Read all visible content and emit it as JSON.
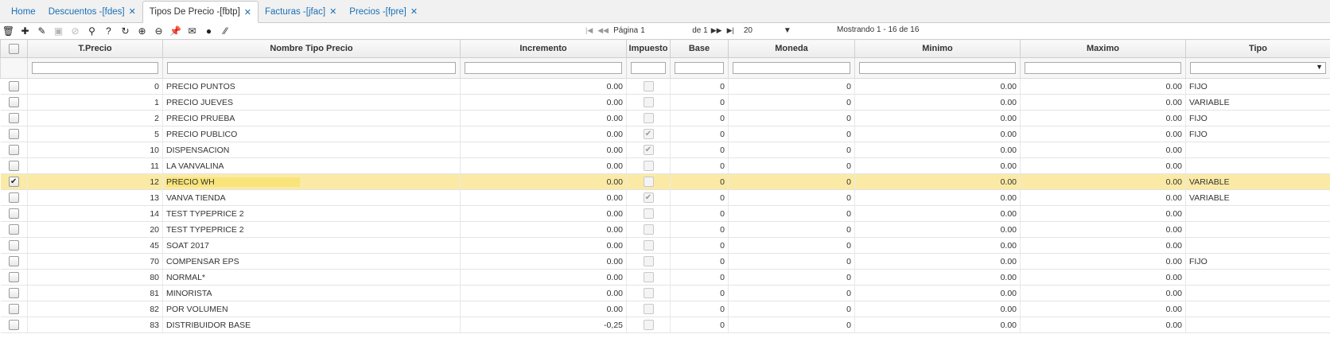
{
  "tabs": [
    {
      "label": "Home",
      "closable": false,
      "active": false
    },
    {
      "label": "Descuentos -[fdes]",
      "closable": true,
      "active": false
    },
    {
      "label": "Tipos De Precio -[fbtp]",
      "closable": true,
      "active": true
    },
    {
      "label": "Facturas -[jfac]",
      "closable": true,
      "active": false
    },
    {
      "label": "Precios -[fpre]",
      "closable": true,
      "active": false
    }
  ],
  "toolbar": {
    "icons": [
      "trash-icon",
      "add-icon",
      "edit-icon",
      "save-icon",
      "cancel-icon",
      "search-icon",
      "help-icon",
      "refresh-icon",
      "zoom-in-icon",
      "zoom-out-icon",
      "pin-icon",
      "mail-icon",
      "plus-circle-icon",
      "resize-icon"
    ]
  },
  "pager": {
    "first": "|◀",
    "prev": "◀◀",
    "page_label": "Página",
    "page_value": "1",
    "of_label": "de 1",
    "next": "▶▶",
    "last": "▶|",
    "page_size": "20",
    "showing": "Mostrando 1 - 16 de 16"
  },
  "columns": {
    "tprecio": "T.Precio",
    "nombre": "Nombre Tipo Precio",
    "incremento": "Incremento",
    "impuesto": "Impuesto",
    "base": "Base",
    "moneda": "Moneda",
    "minimo": "Minimo",
    "maximo": "Maximo",
    "tipo": "Tipo"
  },
  "rows": [
    {
      "id": "0",
      "name": "PRECIO PUNTOS",
      "inc": "0.00",
      "tax": false,
      "base": "0",
      "moneda": "0",
      "min": "0.00",
      "max": "0.00",
      "tipo": "FIJO",
      "selected": false
    },
    {
      "id": "1",
      "name": "PRECIO JUEVES",
      "inc": "0.00",
      "tax": false,
      "base": "0",
      "moneda": "0",
      "min": "0.00",
      "max": "0.00",
      "tipo": "VARIABLE",
      "selected": false
    },
    {
      "id": "2",
      "name": "PRECIO PRUEBA",
      "inc": "0.00",
      "tax": false,
      "base": "0",
      "moneda": "0",
      "min": "0.00",
      "max": "0.00",
      "tipo": "FIJO",
      "selected": false
    },
    {
      "id": "5",
      "name": "PRECIO PUBLICO",
      "inc": "0.00",
      "tax": true,
      "base": "0",
      "moneda": "0",
      "min": "0.00",
      "max": "0.00",
      "tipo": "FIJO",
      "selected": false
    },
    {
      "id": "10",
      "name": "DISPENSACION",
      "inc": "0.00",
      "tax": true,
      "base": "0",
      "moneda": "0",
      "min": "0.00",
      "max": "0.00",
      "tipo": "",
      "selected": false
    },
    {
      "id": "11",
      "name": "LA VANVALINA",
      "inc": "0.00",
      "tax": false,
      "base": "0",
      "moneda": "0",
      "min": "0.00",
      "max": "0.00",
      "tipo": "",
      "selected": false
    },
    {
      "id": "12",
      "name": "PRECIO WH",
      "inc": "0.00",
      "tax": false,
      "base": "0",
      "moneda": "0",
      "min": "0.00",
      "max": "0.00",
      "tipo": "VARIABLE",
      "selected": true
    },
    {
      "id": "13",
      "name": "VANVA TIENDA",
      "inc": "0.00",
      "tax": true,
      "base": "0",
      "moneda": "0",
      "min": "0.00",
      "max": "0.00",
      "tipo": "VARIABLE",
      "selected": false
    },
    {
      "id": "14",
      "name": "TEST TYPEPRICE 2",
      "inc": "0.00",
      "tax": false,
      "base": "0",
      "moneda": "0",
      "min": "0.00",
      "max": "0.00",
      "tipo": "",
      "selected": false
    },
    {
      "id": "20",
      "name": "TEST TYPEPRICE 2",
      "inc": "0.00",
      "tax": false,
      "base": "0",
      "moneda": "0",
      "min": "0.00",
      "max": "0.00",
      "tipo": "",
      "selected": false
    },
    {
      "id": "45",
      "name": "SOAT 2017",
      "inc": "0.00",
      "tax": false,
      "base": "0",
      "moneda": "0",
      "min": "0.00",
      "max": "0.00",
      "tipo": "",
      "selected": false
    },
    {
      "id": "70",
      "name": "COMPENSAR EPS",
      "inc": "0.00",
      "tax": false,
      "base": "0",
      "moneda": "0",
      "min": "0.00",
      "max": "0.00",
      "tipo": "FIJO",
      "selected": false
    },
    {
      "id": "80",
      "name": "NORMAL*",
      "inc": "0.00",
      "tax": false,
      "base": "0",
      "moneda": "0",
      "min": "0.00",
      "max": "0.00",
      "tipo": "",
      "selected": false
    },
    {
      "id": "81",
      "name": "MINORISTA",
      "inc": "0.00",
      "tax": false,
      "base": "0",
      "moneda": "0",
      "min": "0.00",
      "max": "0.00",
      "tipo": "",
      "selected": false
    },
    {
      "id": "82",
      "name": "POR VOLUMEN",
      "inc": "0.00",
      "tax": false,
      "base": "0",
      "moneda": "0",
      "min": "0.00",
      "max": "0.00",
      "tipo": "",
      "selected": false
    },
    {
      "id": "83",
      "name": "DISTRIBUIDOR BASE",
      "inc": "-0,25",
      "tax": false,
      "base": "0",
      "moneda": "0",
      "min": "0.00",
      "max": "0.00",
      "tipo": "",
      "selected": false
    }
  ]
}
